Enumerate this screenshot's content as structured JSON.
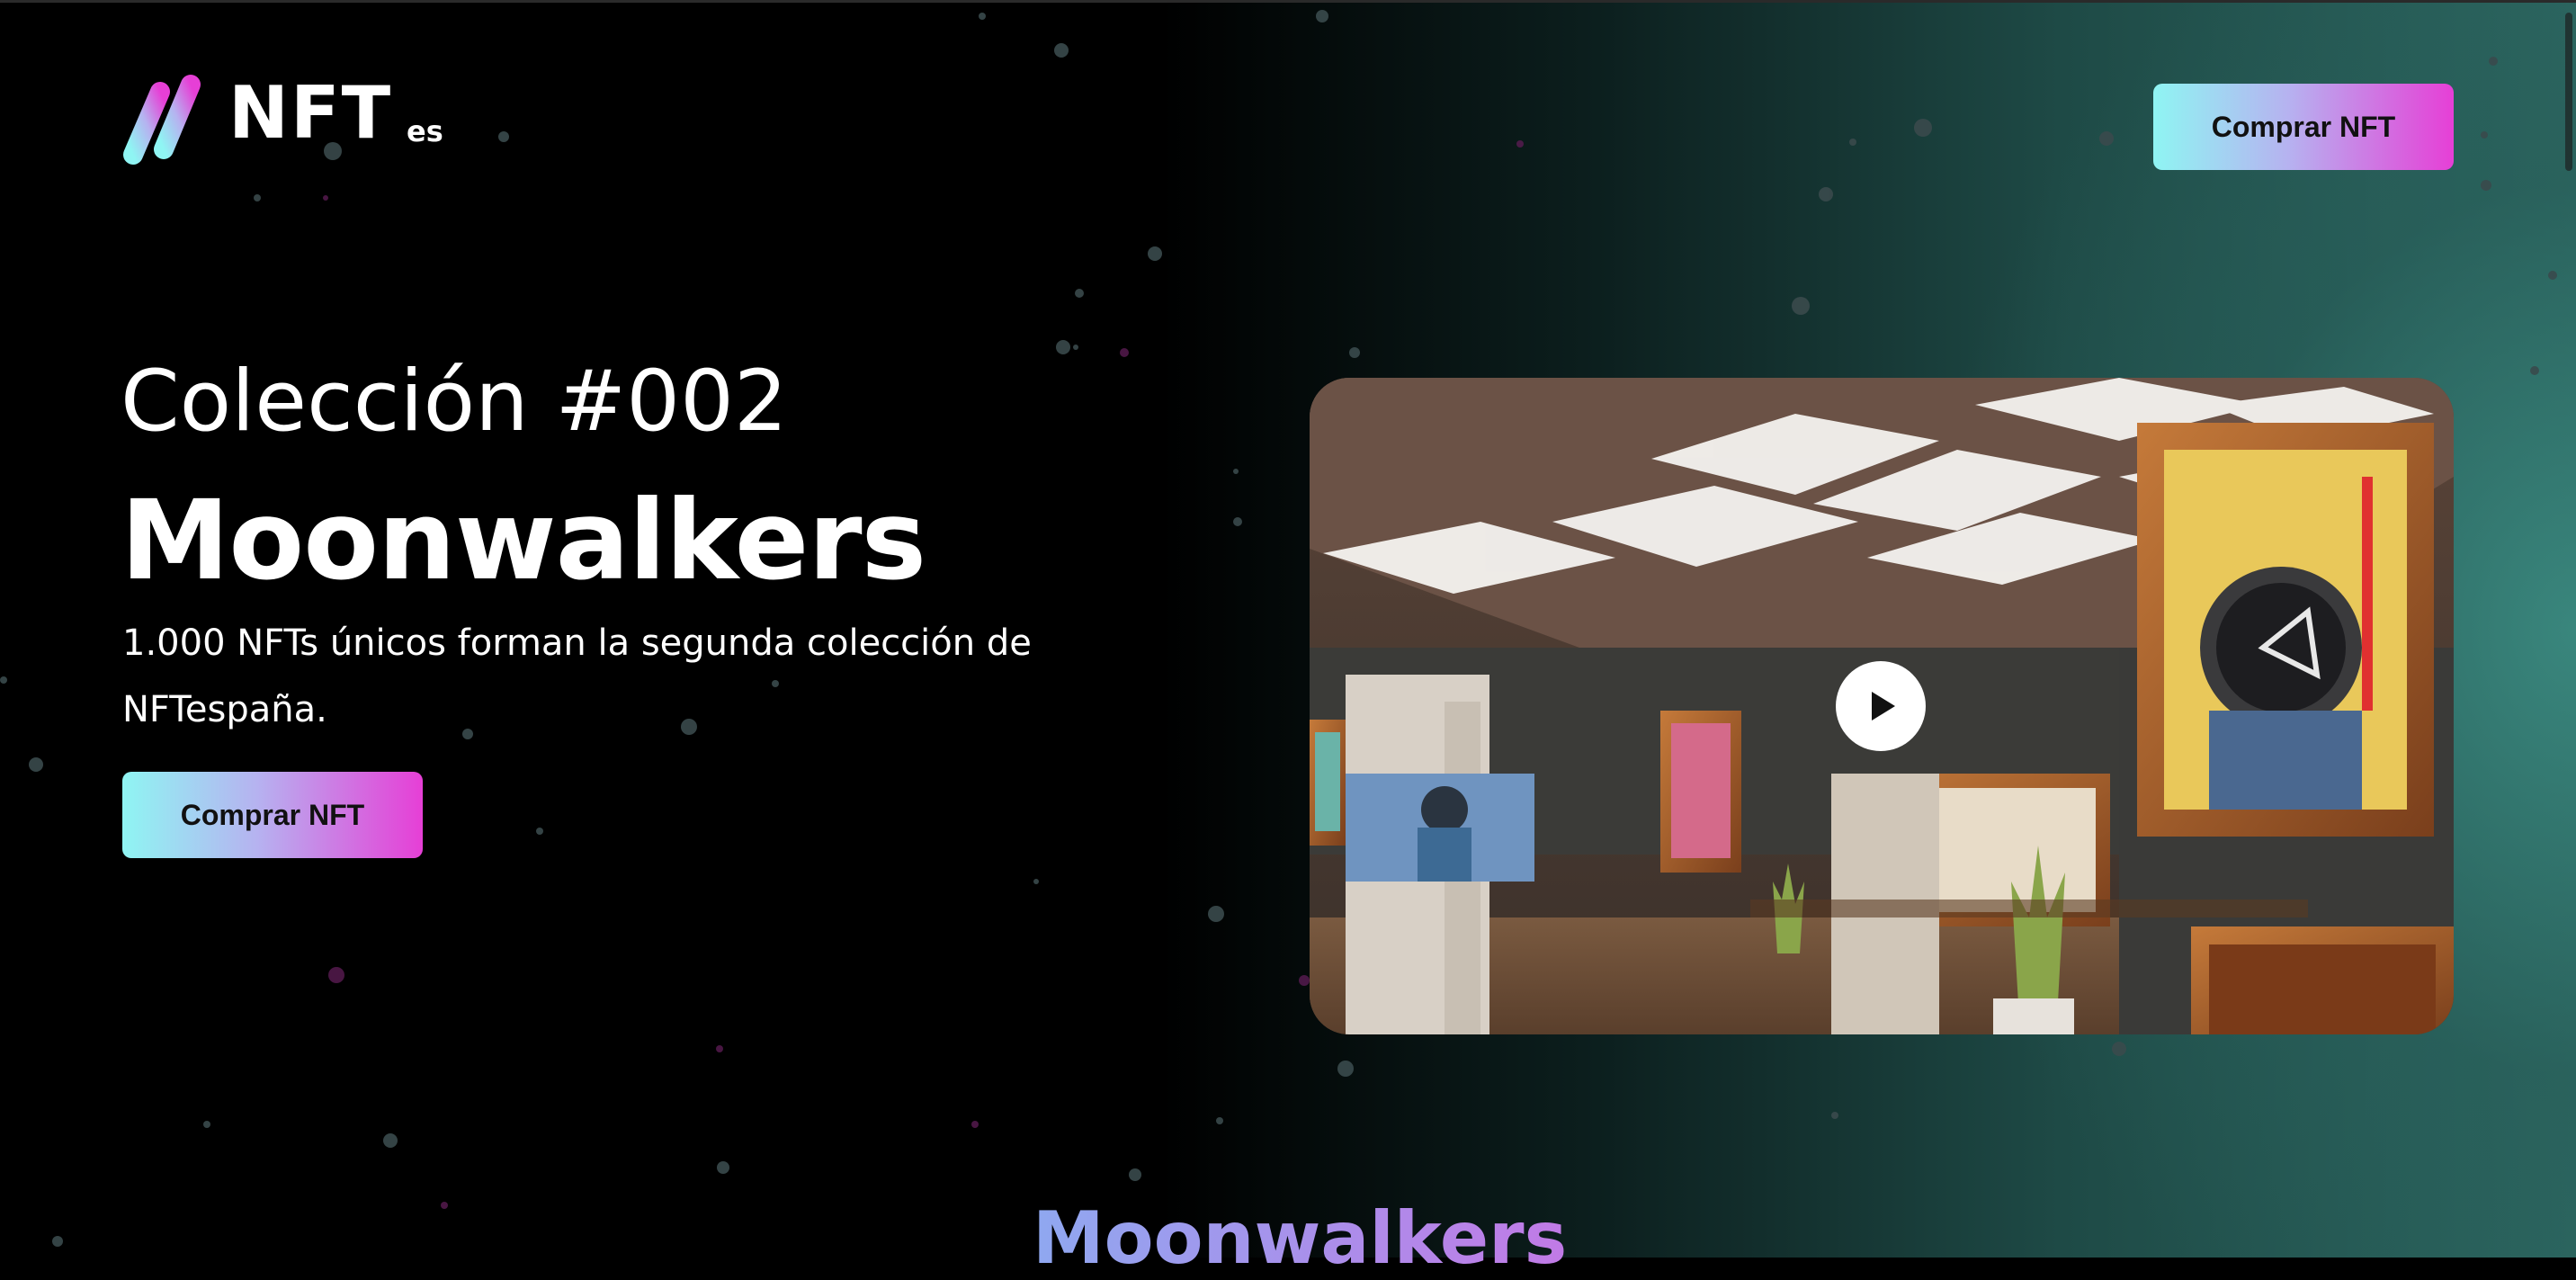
{
  "header": {
    "logo": {
      "brand": "NFT",
      "suffix": "es",
      "colors": [
        "#8ff5f3",
        "#b6b2f0",
        "#e63fd6"
      ]
    },
    "cta_label": "Comprar NFT"
  },
  "hero": {
    "subtitle": "Colección #002",
    "title": "Moonwalkers",
    "description": "1.000 NFTs únicos forman la segunda colección de NFTespaña.",
    "cta_label": "Comprar NFT",
    "video": {
      "thumbnail": "virtual gallery with framed astronaut artwork",
      "play_icon": "play-icon"
    }
  },
  "section": {
    "title": "Moonwalkers"
  },
  "theme": {
    "background": "#000000",
    "accent_teal": "#2c6660",
    "button_gradient_start": "#8ff5f3",
    "button_gradient_end": "#e63fd6"
  }
}
